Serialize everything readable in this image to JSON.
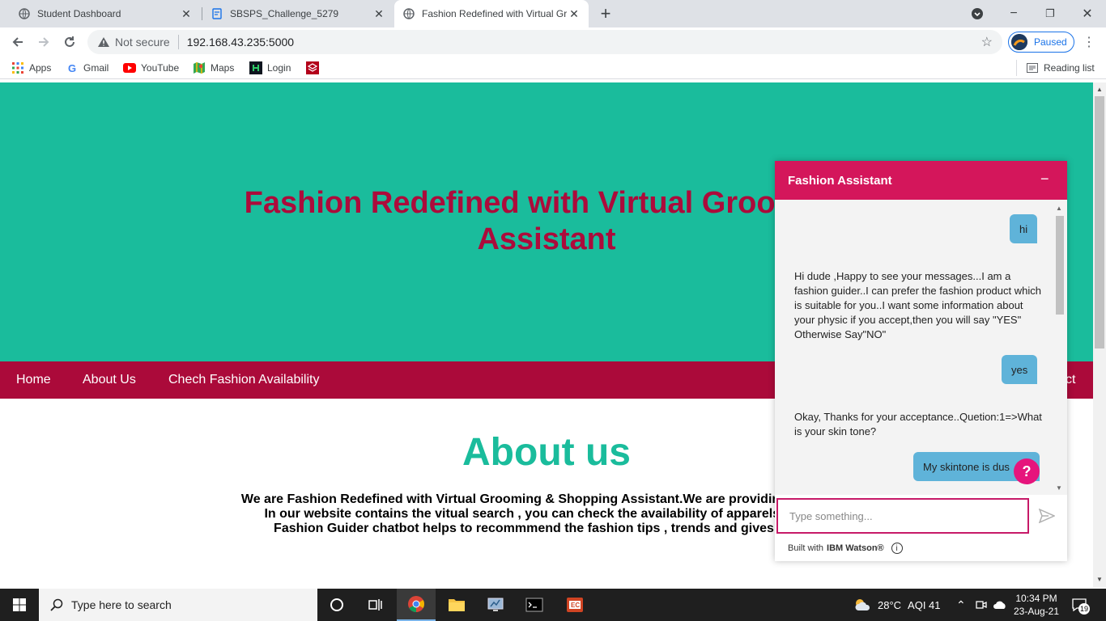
{
  "browser": {
    "tabs": [
      {
        "title": "Student Dashboard",
        "active": false
      },
      {
        "title": "SBSPS_Challenge_5279",
        "active": false
      },
      {
        "title": "Fashion Redefined with Virtual Gr",
        "active": true
      }
    ],
    "security_label": "Not secure",
    "url": "192.168.43.235:5000",
    "profile_status": "Paused",
    "bookmarks": [
      "Apps",
      "Gmail",
      "YouTube",
      "Maps",
      "Login"
    ],
    "reading_list": "Reading list"
  },
  "page": {
    "hero_title_line1": "Fashion Redefined with Virtual Grooming",
    "hero_title_line2": "Assistant",
    "nav": [
      "Home",
      "About Us",
      "Chech Fashion Availability"
    ],
    "nav_right_partial": "ct",
    "about_heading": "About us",
    "about_lines": [
      "We are Fashion Redefined with Virtual Grooming & Shopping Assistant.We are providing the servic",
      "In our website contains the vitual search , you can check the availability of apparels using c",
      "Fashion Guider chatbot helps to recommmend the fashion tips , trends and gives the fas"
    ],
    "colors": {
      "hero_bg": "#1abc9c",
      "title": "#ac0b3b",
      "nav_bg": "#ab0a3a",
      "heading": "#1abc9c"
    }
  },
  "chat": {
    "title": "Fashion Assistant",
    "minimize": "−",
    "messages": [
      {
        "from": "user",
        "text": "hi"
      },
      {
        "from": "bot",
        "text": "Hi dude ,Happy to see your messages...I am a fashion guider..I can prefer the fashion product which is suitable for you..I want some information about your physic if you accept,then you will say \"YES\" Otherwise Say\"NO\""
      },
      {
        "from": "user",
        "text": "yes"
      },
      {
        "from": "bot",
        "text": "Okay, Thanks for your acceptance..Quetion:1=>What is your skin tone?"
      },
      {
        "from": "user",
        "text": "My skintone is dus"
      }
    ],
    "help": "?",
    "input_placeholder": "Type something...",
    "footer_prefix": "Built with",
    "footer_brand": "IBM Watson®",
    "colors": {
      "header": "#d4165b",
      "user_bubble": "#5fb3d9"
    }
  },
  "taskbar": {
    "search_placeholder": "Type here to search",
    "weather": "28°C",
    "aqi": "AQI 41",
    "time": "10:34 PM",
    "date": "23-Aug-21",
    "notifications": "19"
  }
}
